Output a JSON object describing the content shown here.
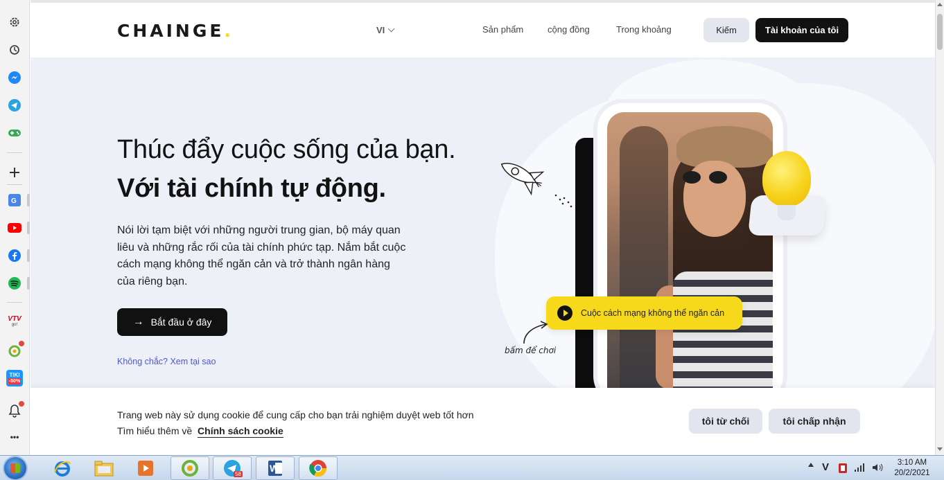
{
  "sidebar": {
    "icons": [
      "gear-icon",
      "history-icon",
      "messenger-icon",
      "telegram-icon",
      "gamepad-icon",
      "add-icon",
      "google-translate-icon",
      "youtube-icon",
      "facebook-icon",
      "spotify-icon",
      "vtv-go-icon",
      "extension-icon",
      "tiki-icon",
      "bell-icon",
      "more-icon"
    ],
    "vtv_label": "VTV",
    "vtv_sub": "go!",
    "tiki_label": "TIKI",
    "tiki_sub": "-50%",
    "more_label": "•••"
  },
  "navbar": {
    "logo": "CHAINGE",
    "logo_dot": ".",
    "lang": "VI",
    "links": [
      "Sản phẩm",
      "cộng đồng",
      "Trong khoảng"
    ],
    "login_label": "Kiếm",
    "account_label": "Tài khoản của tôi"
  },
  "hero": {
    "headline_1": "Thúc đẩy cuộc sống của bạn.",
    "headline_2": "Với tài chính tự động.",
    "description": "Nói lời tạm biệt với những người trung gian, bộ máy quan liêu và những rắc rối của tài chính phức tạp. Nắm bắt cuộc cách mạng không thể ngăn cản và trở thành ngân hàng của riêng bạn.",
    "cta_arrow": "→",
    "cta_label": "Bắt đầu ở đây",
    "why_link": "Không chắc? Xem tại sao",
    "video_label": "Cuộc cách mạng không thể ngăn cản",
    "video_hint": "bấm để chơi"
  },
  "cookie": {
    "line_1": "Trang web này sử dụng cookie để cung cấp cho bạn trải nghiệm duyệt web tốt hơn",
    "line_2": "Tìm hiểu thêm về",
    "policy_link": "Chính sách cookie",
    "decline_label": "tôi từ chối",
    "accept_label": "tôi chấp nhận"
  },
  "taskbar": {
    "apps": [
      "internet-explorer-icon",
      "file-explorer-icon",
      "media-player-icon",
      "coccoc-browser-icon",
      "telegram-icon",
      "word-icon",
      "chrome-icon"
    ],
    "telegram_badge": "58",
    "word_label": "W",
    "tray_lang": "V",
    "time": "3:10 AM",
    "date": "20/2/2021"
  },
  "colors": {
    "accent_yellow": "#f7d91b",
    "primary_dark": "#111111",
    "page_bg": "#eef0f8",
    "link_blue": "#4b59c7"
  }
}
